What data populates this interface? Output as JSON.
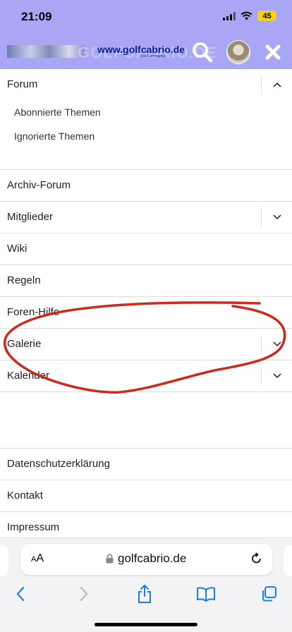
{
  "status": {
    "time": "21:09",
    "battery": "45"
  },
  "header": {
    "logo_url_text": "www.golfcabrio.de",
    "logo_tagline": "Die Community",
    "logo_ghost_text": "GOLFCABRIO.DE"
  },
  "menu": {
    "forum": {
      "label": "Forum",
      "children": [
        "Abonnierte Themen",
        "Ignorierte Themen"
      ]
    },
    "items": [
      {
        "label": "Archiv-Forum",
        "has_toggle": false
      },
      {
        "label": "Mitglieder",
        "has_toggle": true
      },
      {
        "label": "Wiki",
        "has_toggle": false
      },
      {
        "label": "Regeln",
        "has_toggle": false
      },
      {
        "label": "Foren-Hilfe",
        "has_toggle": false
      },
      {
        "label": "Galerie",
        "has_toggle": true
      },
      {
        "label": "Kalender",
        "has_toggle": true
      }
    ],
    "footer_items": [
      "Datenschutzerklärung",
      "Kontakt",
      "Impressum"
    ]
  },
  "browser": {
    "text_size_label_small": "A",
    "text_size_label_large": "A",
    "url": "golfcabrio.de"
  },
  "colors": {
    "header_bg": "#a9a6f5",
    "annotation": "#cc2a1a",
    "battery": "#f5d213",
    "toolbar_blue": "#1a7cf5"
  }
}
